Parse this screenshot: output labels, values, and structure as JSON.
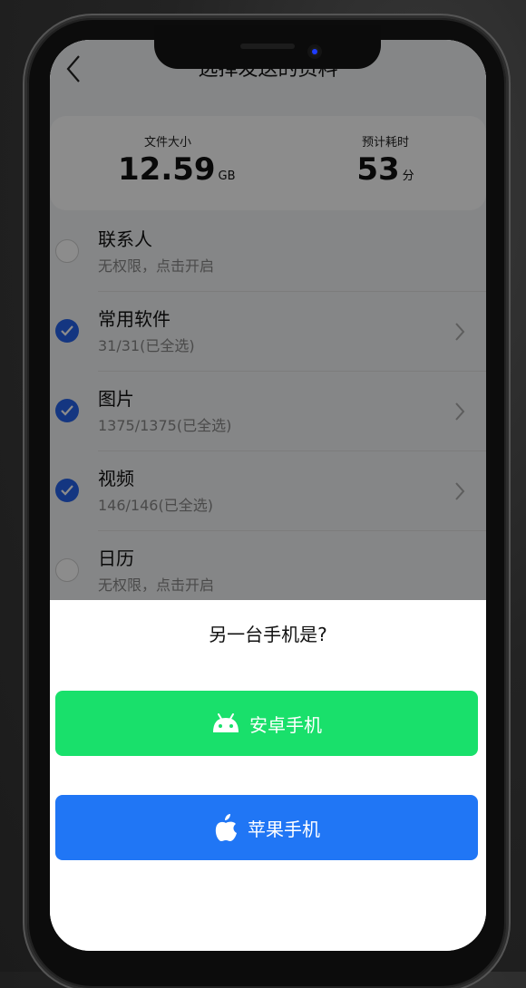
{
  "header": {
    "title": "选择发送的资料"
  },
  "stats": {
    "size_label": "文件大小",
    "size_value": "12.59",
    "size_unit": "GB",
    "time_label": "预计耗时",
    "time_value": "53",
    "time_unit": "分"
  },
  "items": [
    {
      "title": "联系人",
      "sub": "无权限，点击开启",
      "checked": false
    },
    {
      "title": "常用软件",
      "sub": "31/31(已全选)",
      "checked": true
    },
    {
      "title": "图片",
      "sub": "1375/1375(已全选)",
      "checked": true
    },
    {
      "title": "视频",
      "sub": "146/146(已全选)",
      "checked": true
    },
    {
      "title": "日历",
      "sub": "无权限，点击开启",
      "checked": false
    }
  ],
  "sheet": {
    "title": "另一台手机是?",
    "android_label": "安卓手机",
    "ios_label": "苹果手机"
  },
  "colors": {
    "android": "#19e06b",
    "ios": "#2076f5",
    "check": "#2563eb"
  },
  "icons": {
    "android": "android-icon",
    "apple": "apple-icon",
    "back": "chevron-left-icon"
  }
}
